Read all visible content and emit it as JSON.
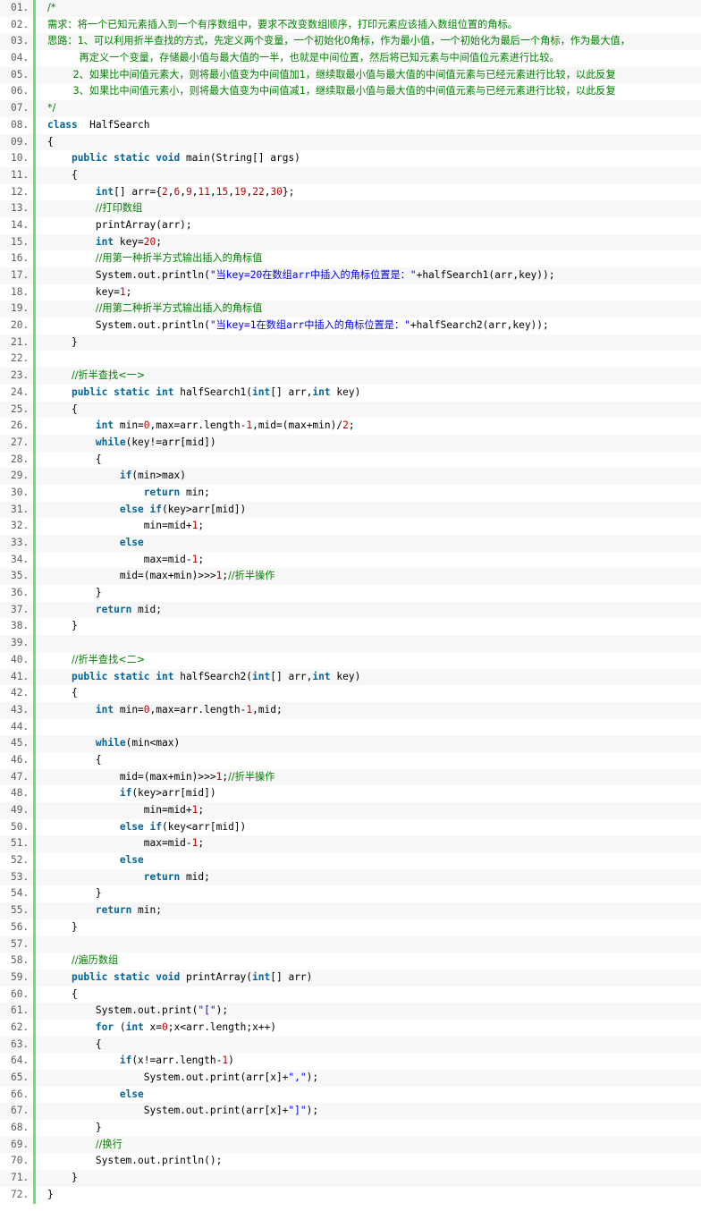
{
  "code_view": {
    "language": "java",
    "colors": {
      "gutter_border": "#6ce26c",
      "line_number": "#5c5c5c",
      "comment": "#008200",
      "keyword": "#006699",
      "string": "#0000ff",
      "number": "#c00000",
      "plain": "#000000",
      "row_alt": "#f7f7f7"
    },
    "lines": [
      {
        "num": "01.",
        "tokens": [
          [
            "c",
            "/*"
          ]
        ]
      },
      {
        "num": "02.",
        "tokens": [
          [
            "c",
            "需求：将一个已知元素插入到一个有序数组中，要求不改变数组顺序，打印元素应该插入数组位置的角标。"
          ]
        ]
      },
      {
        "num": "03.",
        "tokens": [
          [
            "c",
            "思路：1、可以利用折半查找的方式，先定义两个变量，一个初始化0角标，作为最小值，一个初始化为最后一个角标，作为最大值，"
          ]
        ]
      },
      {
        "num": "04.",
        "tokens": [
          [
            "c",
            "          再定义一个变量，存储最小值与最大值的一半，也就是中间位置，然后将已知元素与中间值位元素进行比较。"
          ]
        ]
      },
      {
        "num": "05.",
        "tokens": [
          [
            "c",
            "        2、如果比中间值元素大，则将最小值变为中间值加1，继续取最小值与最大值的中间值元素与已经元素进行比较，以此反复"
          ]
        ]
      },
      {
        "num": "06.",
        "tokens": [
          [
            "c",
            "        3、如果比中间值元素小，则将最大值变为中间值减1，继续取最小值与最大值的中间值元素与已经元素进行比较，以此反复"
          ]
        ]
      },
      {
        "num": "07.",
        "tokens": [
          [
            "c",
            "*/"
          ]
        ]
      },
      {
        "num": "08.",
        "tokens": [
          [
            "k",
            "class"
          ],
          [
            "p",
            "  HalfSearch"
          ]
        ]
      },
      {
        "num": "09.",
        "tokens": [
          [
            "p",
            "{"
          ]
        ]
      },
      {
        "num": "10.",
        "tokens": [
          [
            "p",
            "    "
          ],
          [
            "k",
            "public static void"
          ],
          [
            "p",
            " main(String[] args)"
          ]
        ]
      },
      {
        "num": "11.",
        "tokens": [
          [
            "p",
            "    {"
          ]
        ]
      },
      {
        "num": "12.",
        "tokens": [
          [
            "p",
            "        "
          ],
          [
            "k",
            "int"
          ],
          [
            "p",
            "[] arr={"
          ],
          [
            "n",
            "2"
          ],
          [
            "p",
            ","
          ],
          [
            "n",
            "6"
          ],
          [
            "p",
            ","
          ],
          [
            "n",
            "9"
          ],
          [
            "p",
            ","
          ],
          [
            "n",
            "11"
          ],
          [
            "p",
            ","
          ],
          [
            "n",
            "15"
          ],
          [
            "p",
            ","
          ],
          [
            "n",
            "19"
          ],
          [
            "p",
            ","
          ],
          [
            "n",
            "22"
          ],
          [
            "p",
            ","
          ],
          [
            "n",
            "30"
          ],
          [
            "p",
            "};"
          ]
        ]
      },
      {
        "num": "13.",
        "tokens": [
          [
            "p",
            "        "
          ],
          [
            "c",
            "//打印数组"
          ]
        ]
      },
      {
        "num": "14.",
        "tokens": [
          [
            "p",
            "        printArray(arr);"
          ]
        ]
      },
      {
        "num": "15.",
        "tokens": [
          [
            "p",
            "        "
          ],
          [
            "k",
            "int"
          ],
          [
            "p",
            " key="
          ],
          [
            "n",
            "20"
          ],
          [
            "p",
            ";"
          ]
        ]
      },
      {
        "num": "16.",
        "tokens": [
          [
            "p",
            "        "
          ],
          [
            "c",
            "//用第一种折半方式输出插入的角标值"
          ]
        ]
      },
      {
        "num": "17.",
        "tokens": [
          [
            "p",
            "        System.out.println("
          ],
          [
            "s",
            "\"当key=20在数组arr中插入的角标位置是：\""
          ],
          [
            "p",
            "+halfSearch1(arr,key));"
          ]
        ]
      },
      {
        "num": "18.",
        "tokens": [
          [
            "p",
            "        key="
          ],
          [
            "n",
            "1"
          ],
          [
            "p",
            ";"
          ]
        ]
      },
      {
        "num": "19.",
        "tokens": [
          [
            "p",
            "        "
          ],
          [
            "c",
            "//用第二种折半方式输出插入的角标值"
          ]
        ]
      },
      {
        "num": "20.",
        "tokens": [
          [
            "p",
            "        System.out.println("
          ],
          [
            "s",
            "\"当key=1在数组arr中插入的角标位置是：\""
          ],
          [
            "p",
            "+halfSearch2(arr,key));"
          ]
        ]
      },
      {
        "num": "21.",
        "tokens": [
          [
            "p",
            "    }"
          ]
        ]
      },
      {
        "num": "22.",
        "tokens": [
          [
            "p",
            " "
          ]
        ]
      },
      {
        "num": "23.",
        "tokens": [
          [
            "p",
            "    "
          ],
          [
            "c",
            "//折半查找<一>"
          ]
        ]
      },
      {
        "num": "24.",
        "tokens": [
          [
            "p",
            "    "
          ],
          [
            "k",
            "public static int"
          ],
          [
            "p",
            " halfSearch1("
          ],
          [
            "k",
            "int"
          ],
          [
            "p",
            "[] arr,"
          ],
          [
            "k",
            "int"
          ],
          [
            "p",
            " key)"
          ]
        ]
      },
      {
        "num": "25.",
        "tokens": [
          [
            "p",
            "    {"
          ]
        ]
      },
      {
        "num": "26.",
        "tokens": [
          [
            "p",
            "        "
          ],
          [
            "k",
            "int"
          ],
          [
            "p",
            " min="
          ],
          [
            "n",
            "0"
          ],
          [
            "p",
            ",max=arr.length-"
          ],
          [
            "n",
            "1"
          ],
          [
            "p",
            ",mid=(max+min)/"
          ],
          [
            "n",
            "2"
          ],
          [
            "p",
            ";"
          ]
        ]
      },
      {
        "num": "27.",
        "tokens": [
          [
            "p",
            "        "
          ],
          [
            "k",
            "while"
          ],
          [
            "p",
            "(key!=arr[mid])"
          ]
        ]
      },
      {
        "num": "28.",
        "tokens": [
          [
            "p",
            "        {"
          ]
        ]
      },
      {
        "num": "29.",
        "tokens": [
          [
            "p",
            "            "
          ],
          [
            "k",
            "if"
          ],
          [
            "p",
            "(min>max)"
          ]
        ]
      },
      {
        "num": "30.",
        "tokens": [
          [
            "p",
            "                "
          ],
          [
            "k",
            "return"
          ],
          [
            "p",
            " min;"
          ]
        ]
      },
      {
        "num": "31.",
        "tokens": [
          [
            "p",
            "            "
          ],
          [
            "k",
            "else if"
          ],
          [
            "p",
            "(key>arr[mid])"
          ]
        ]
      },
      {
        "num": "32.",
        "tokens": [
          [
            "p",
            "                min=mid+"
          ],
          [
            "n",
            "1"
          ],
          [
            "p",
            ";"
          ]
        ]
      },
      {
        "num": "33.",
        "tokens": [
          [
            "p",
            "            "
          ],
          [
            "k",
            "else"
          ]
        ]
      },
      {
        "num": "34.",
        "tokens": [
          [
            "p",
            "                max=mid-"
          ],
          [
            "n",
            "1"
          ],
          [
            "p",
            ";"
          ]
        ]
      },
      {
        "num": "35.",
        "tokens": [
          [
            "p",
            "            mid=(max+min)>>>"
          ],
          [
            "n",
            "1"
          ],
          [
            "p",
            ";"
          ],
          [
            "c",
            "//折半操作"
          ]
        ]
      },
      {
        "num": "36.",
        "tokens": [
          [
            "p",
            "        }"
          ]
        ]
      },
      {
        "num": "37.",
        "tokens": [
          [
            "p",
            "        "
          ],
          [
            "k",
            "return"
          ],
          [
            "p",
            " mid;"
          ]
        ]
      },
      {
        "num": "38.",
        "tokens": [
          [
            "p",
            "    }"
          ]
        ]
      },
      {
        "num": "39.",
        "tokens": [
          [
            "p",
            " "
          ]
        ]
      },
      {
        "num": "40.",
        "tokens": [
          [
            "p",
            "    "
          ],
          [
            "c",
            "//折半查找<二>"
          ]
        ]
      },
      {
        "num": "41.",
        "tokens": [
          [
            "p",
            "    "
          ],
          [
            "k",
            "public static int"
          ],
          [
            "p",
            " halfSearch2("
          ],
          [
            "k",
            "int"
          ],
          [
            "p",
            "[] arr,"
          ],
          [
            "k",
            "int"
          ],
          [
            "p",
            " key)"
          ]
        ]
      },
      {
        "num": "42.",
        "tokens": [
          [
            "p",
            "    {"
          ]
        ]
      },
      {
        "num": "43.",
        "tokens": [
          [
            "p",
            "        "
          ],
          [
            "k",
            "int"
          ],
          [
            "p",
            " min="
          ],
          [
            "n",
            "0"
          ],
          [
            "p",
            ",max=arr.length-"
          ],
          [
            "n",
            "1"
          ],
          [
            "p",
            ",mid;"
          ]
        ]
      },
      {
        "num": "44.",
        "tokens": [
          [
            "p",
            " "
          ]
        ]
      },
      {
        "num": "45.",
        "tokens": [
          [
            "p",
            "        "
          ],
          [
            "k",
            "while"
          ],
          [
            "p",
            "(min<max)"
          ]
        ]
      },
      {
        "num": "46.",
        "tokens": [
          [
            "p",
            "        {"
          ]
        ]
      },
      {
        "num": "47.",
        "tokens": [
          [
            "p",
            "            mid=(max+min)>>>"
          ],
          [
            "n",
            "1"
          ],
          [
            "p",
            ";"
          ],
          [
            "c",
            "//折半操作"
          ]
        ]
      },
      {
        "num": "48.",
        "tokens": [
          [
            "p",
            "            "
          ],
          [
            "k",
            "if"
          ],
          [
            "p",
            "(key>arr[mid])"
          ]
        ]
      },
      {
        "num": "49.",
        "tokens": [
          [
            "p",
            "                min=mid+"
          ],
          [
            "n",
            "1"
          ],
          [
            "p",
            ";"
          ]
        ]
      },
      {
        "num": "50.",
        "tokens": [
          [
            "p",
            "            "
          ],
          [
            "k",
            "else if"
          ],
          [
            "p",
            "(key<arr[mid])"
          ]
        ]
      },
      {
        "num": "51.",
        "tokens": [
          [
            "p",
            "                max=mid-"
          ],
          [
            "n",
            "1"
          ],
          [
            "p",
            ";"
          ]
        ]
      },
      {
        "num": "52.",
        "tokens": [
          [
            "p",
            "            "
          ],
          [
            "k",
            "else"
          ]
        ]
      },
      {
        "num": "53.",
        "tokens": [
          [
            "p",
            "                "
          ],
          [
            "k",
            "return"
          ],
          [
            "p",
            " mid;"
          ]
        ]
      },
      {
        "num": "54.",
        "tokens": [
          [
            "p",
            "        }"
          ]
        ]
      },
      {
        "num": "55.",
        "tokens": [
          [
            "p",
            "        "
          ],
          [
            "k",
            "return"
          ],
          [
            "p",
            " min;"
          ]
        ]
      },
      {
        "num": "56.",
        "tokens": [
          [
            "p",
            "    }"
          ]
        ]
      },
      {
        "num": "57.",
        "tokens": [
          [
            "p",
            " "
          ]
        ]
      },
      {
        "num": "58.",
        "tokens": [
          [
            "p",
            "    "
          ],
          [
            "c",
            "//遍历数组"
          ]
        ]
      },
      {
        "num": "59.",
        "tokens": [
          [
            "p",
            "    "
          ],
          [
            "k",
            "public static void"
          ],
          [
            "p",
            " printArray("
          ],
          [
            "k",
            "int"
          ],
          [
            "p",
            "[] arr)"
          ]
        ]
      },
      {
        "num": "60.",
        "tokens": [
          [
            "p",
            "    {"
          ]
        ]
      },
      {
        "num": "61.",
        "tokens": [
          [
            "p",
            "        System.out.print("
          ],
          [
            "s",
            "\"[\""
          ],
          [
            "p",
            ");"
          ]
        ]
      },
      {
        "num": "62.",
        "tokens": [
          [
            "p",
            "        "
          ],
          [
            "k",
            "for"
          ],
          [
            "p",
            " ("
          ],
          [
            "k",
            "int"
          ],
          [
            "p",
            " x="
          ],
          [
            "n",
            "0"
          ],
          [
            "p",
            ";x<arr.length;x++)"
          ]
        ]
      },
      {
        "num": "63.",
        "tokens": [
          [
            "p",
            "        {"
          ]
        ]
      },
      {
        "num": "64.",
        "tokens": [
          [
            "p",
            "            "
          ],
          [
            "k",
            "if"
          ],
          [
            "p",
            "(x!=arr.length-"
          ],
          [
            "n",
            "1"
          ],
          [
            "p",
            ")"
          ]
        ]
      },
      {
        "num": "65.",
        "tokens": [
          [
            "p",
            "                System.out.print(arr[x]+"
          ],
          [
            "s",
            "\",\""
          ],
          [
            "p",
            ");"
          ]
        ]
      },
      {
        "num": "66.",
        "tokens": [
          [
            "p",
            "            "
          ],
          [
            "k",
            "else"
          ]
        ]
      },
      {
        "num": "67.",
        "tokens": [
          [
            "p",
            "                System.out.print(arr[x]+"
          ],
          [
            "s",
            "\"]\""
          ],
          [
            "p",
            ");"
          ]
        ]
      },
      {
        "num": "68.",
        "tokens": [
          [
            "p",
            "        }"
          ]
        ]
      },
      {
        "num": "69.",
        "tokens": [
          [
            "p",
            "        "
          ],
          [
            "c",
            "//换行"
          ]
        ]
      },
      {
        "num": "70.",
        "tokens": [
          [
            "p",
            "        System.out.println();"
          ]
        ]
      },
      {
        "num": "71.",
        "tokens": [
          [
            "p",
            "    }"
          ]
        ]
      },
      {
        "num": "72.",
        "tokens": [
          [
            "p",
            "}"
          ]
        ]
      }
    ]
  }
}
